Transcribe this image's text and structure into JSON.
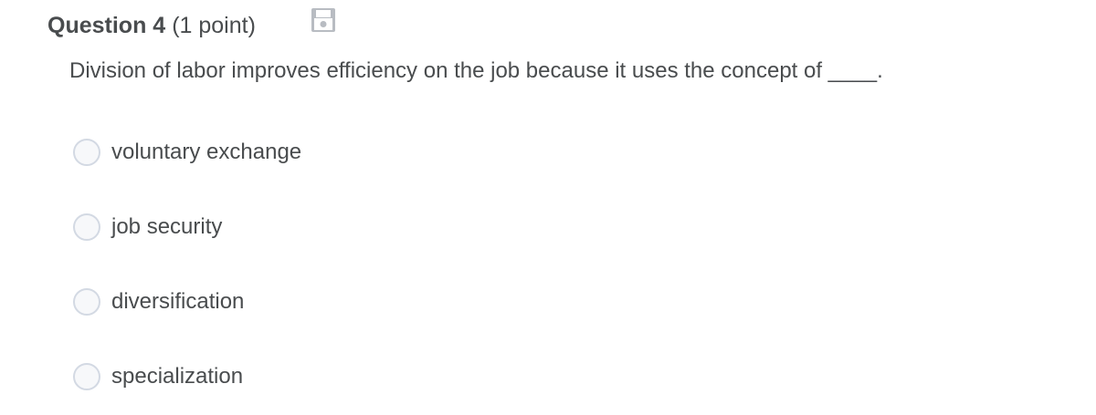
{
  "question": {
    "title": "Question 4",
    "points": "(1 point)",
    "text": "Division of labor improves efficiency on the job because it uses the concept of ____.",
    "save_icon": "floppy-disk-icon"
  },
  "options": [
    {
      "label": "voluntary exchange",
      "selected": false
    },
    {
      "label": "job security",
      "selected": false
    },
    {
      "label": "diversification",
      "selected": false
    },
    {
      "label": "specialization",
      "selected": false
    }
  ],
  "colors": {
    "text": "#494c4e",
    "radio_border": "#d3d9e3",
    "radio_fill": "#f7f8fa",
    "icon": "#b8bcc2"
  }
}
